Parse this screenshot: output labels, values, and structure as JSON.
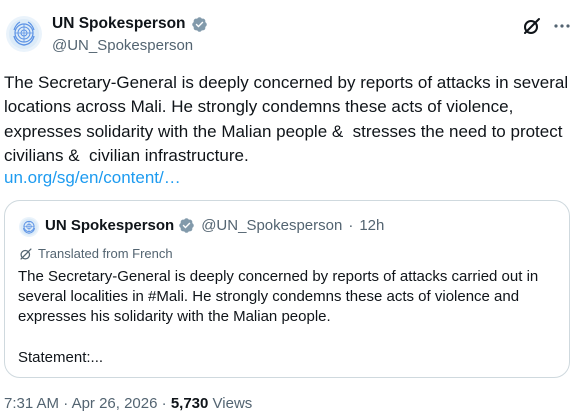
{
  "author": {
    "name": "UN Spokesperson",
    "handle": "@UN_Spokesperson",
    "verified": true
  },
  "tweet": {
    "text": "The Secretary-General is deeply concerned by reports of attacks in several locations across Mali. He strongly condemns these acts of violence, expresses solidarity with the Malian people &  stresses the need to protect civilians &  civilian infrastructure.",
    "link": "un.org/sg/en/content/…"
  },
  "quoted": {
    "name": "UN Spokesperson",
    "handle": "@UN_Spokesperson",
    "separator": "·",
    "time": "12h",
    "translated_label": "Translated from French",
    "text": "The Secretary-General is deeply concerned by reports of attacks carried out in several localities in #Mali. He strongly condemns these acts of violence and expresses his solidarity with the Malian people.\n\nStatement:..."
  },
  "footer": {
    "time": "7:31 AM",
    "sep1": "·",
    "date": "Apr 26, 2026",
    "sep2": "·",
    "views_count": "5,730",
    "views_label": "Views"
  },
  "icons": {
    "avatar": "un-emblem-icon",
    "badge": "verified-badge-icon",
    "grok": "grok-icon",
    "more": "more-icon",
    "translate": "translate-icon"
  },
  "colors": {
    "link": "#1d9bf0",
    "muted": "#536471",
    "text": "#0f1419",
    "badge": "#829aab",
    "border": "#cfd9de"
  }
}
